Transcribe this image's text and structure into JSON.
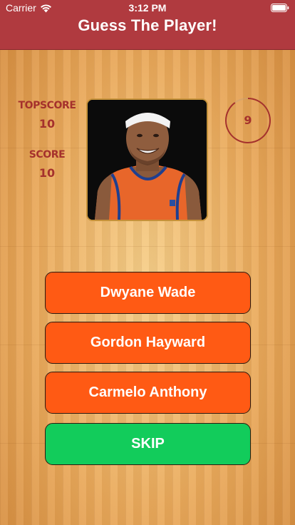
{
  "status_bar": {
    "carrier": "Carrier",
    "time": "3:12 PM"
  },
  "header": {
    "title": "Guess The Player!",
    "color": "#b03a3f"
  },
  "scores": {
    "topscore_label": "TOPSCORE",
    "topscore_value": "10",
    "score_label": "SCORE",
    "score_value": "10"
  },
  "timer": {
    "value": "9",
    "color": "#a5312c"
  },
  "player_photo": {
    "icon": "player-photo-image"
  },
  "answers": [
    {
      "label": "Dwyane Wade"
    },
    {
      "label": "Gordon Hayward"
    },
    {
      "label": "Carmelo Anthony"
    }
  ],
  "skip": {
    "label": "SKIP",
    "color": "#12cc5b"
  },
  "answer_color": "#ff5a14"
}
